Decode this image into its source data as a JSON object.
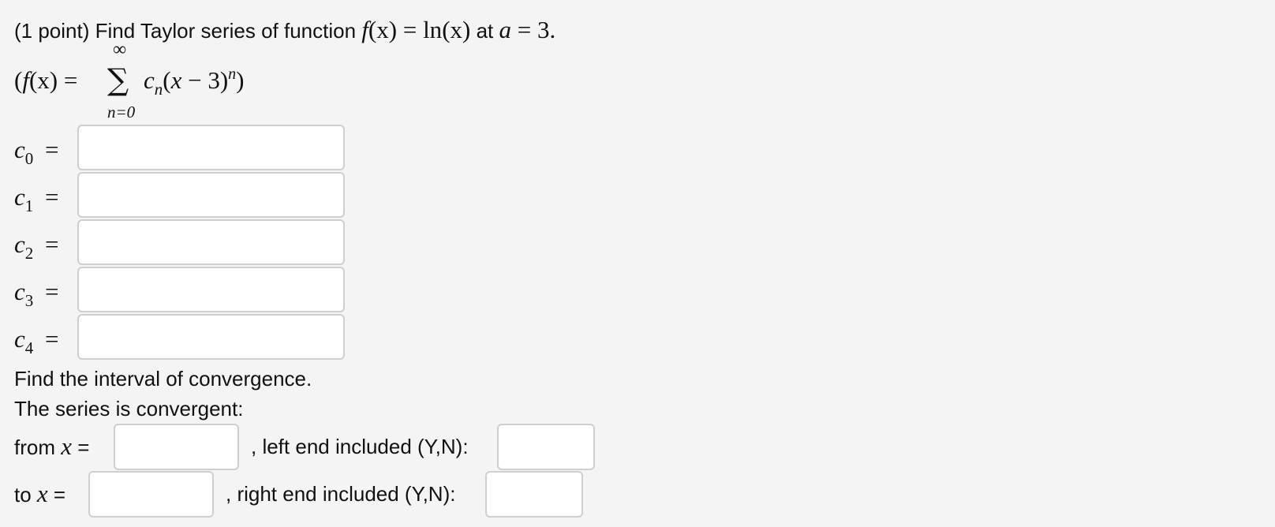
{
  "problem": {
    "prefix": "(1 point) Find Taylor series of function ",
    "f_letter": "f",
    "fx_arg": "(x)",
    "equals": " = ",
    "ln_text": "ln",
    "ln_arg": "(x)",
    "at_text": " at ",
    "a_letter": "a",
    "a_value": " = 3."
  },
  "series": {
    "open_paren": "(",
    "f_letter": "f",
    "fx_arg": "(x)",
    "equals": " = ",
    "sigma": "∑",
    "upper": "∞",
    "lower": "n=0",
    "c_letter": "c",
    "c_sub": "n",
    "term_open": "(",
    "x_letter": "x",
    "term_minus": " − 3)",
    "power": "n",
    "close_paren": ")"
  },
  "coefficients": [
    {
      "letter": "c",
      "index": "0",
      "equals": "=",
      "value": ""
    },
    {
      "letter": "c",
      "index": "1",
      "equals": "=",
      "value": ""
    },
    {
      "letter": "c",
      "index": "2",
      "equals": "=",
      "value": ""
    },
    {
      "letter": "c",
      "index": "3",
      "equals": "=",
      "value": ""
    },
    {
      "letter": "c",
      "index": "4",
      "equals": "=",
      "value": ""
    }
  ],
  "interval": {
    "heading": "Find the interval of convergence.",
    "subheading": "The series is convergent:",
    "from_label": "from ",
    "from_var": "x",
    "from_eq": " =",
    "from_value": "",
    "left_label": ", left end included (Y,N):",
    "left_value": "",
    "to_label": "to ",
    "to_var": "x",
    "to_eq": " =",
    "to_value": "",
    "right_label": ", right end included (Y,N):",
    "right_value": ""
  }
}
